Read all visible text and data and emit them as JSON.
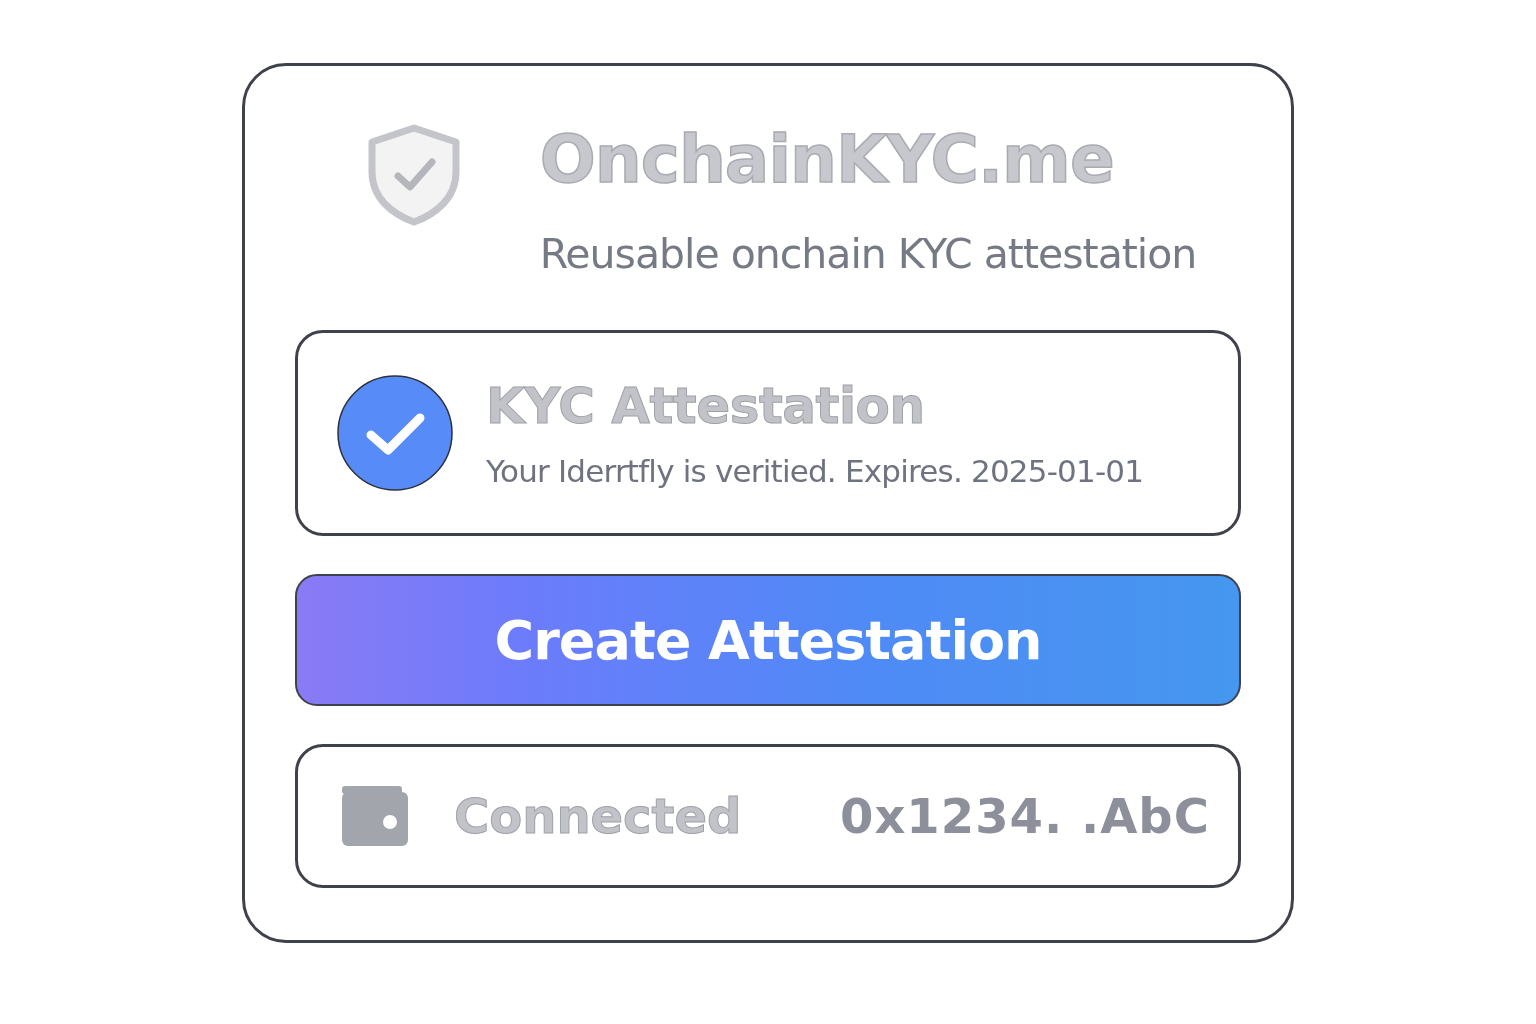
{
  "brand": {
    "name": "OnchainKYC.me",
    "tagline": "Reusable onchain KYC attestation"
  },
  "attestation": {
    "title": "KYC Attestation",
    "detail": "Your Iderrtfly is veritied. Expires. 2025-01-01",
    "verified": true
  },
  "action_button": {
    "label": "Create Attestation"
  },
  "wallet": {
    "status": "Connected",
    "address": "0x1234. .AbC"
  }
}
